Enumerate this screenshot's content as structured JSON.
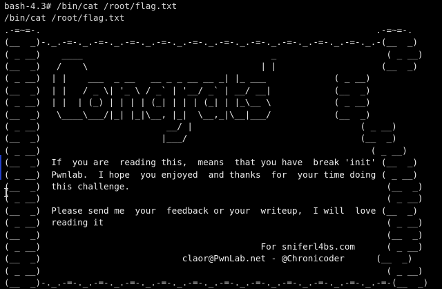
{
  "terminal": {
    "prompt_line": "bash-4.3# /bin/cat /root/flag.txt",
    "echo_line": "/bin/cat /root/flag.txt",
    "border": {
      "top": ".-=~=-.                                                                .-=~=-.",
      "bottom_chain": "(__  _)-._.-=-._.-=-._.-=-._.-=-._.-=-._.-=-._.-=-._.-=-._.-=-._.-=-._.-(__  _)"
    },
    "ascii_title": [
      "(__  _)-._.-=-._.-=-._.-=-._.-=-._.-=-._.-=-._.-=-._.-=-._.-=-._.-=-._.-(__  _)",
      "( _ __)    ____                                    _                     ( _ __)",
      "(__  _)   /    \\                                 | |                    (__  _)",
      "( _ __)  | |    ___  _ __   __ _ _ __ __ _| |_ ___             ( _ __)",
      "(__  _)  | |   / _ \\| '_ \\ / _` | '__/ _` | __/ __|            (__  _)",
      "( _ __)  | |  | (_) | | | | (_| | | | (_| | |_\\__ \\            ( _ __)",
      "(__  _)   \\____\\___/|_| |_|\\__, |_|  \\__,_|\\__|___/            (__  _)",
      "( _ __)                        __/ |                                ( _ __)",
      "(__  _)                       |___/                                 (__  _)",
      "( _ __)                                                               ( _ __)"
    ],
    "message": [
      "(__  _)  If  you are  reading this,  means  that you have  break 'init' (__  _)",
      "( _ __)  Pwnlab.  I hope  you enjoyed  and thanks  for  your time doing ( _ __)",
      "(__  _)  this challenge.                                                 (__  _)",
      "( _ __)                                                                  ( _ __)",
      "(__  _)  Please send me  your  feedback or your  writeup,  I will  love (__  _)",
      "( _ __)  reading it                                                      ( _ __)",
      "(__  _)                                                                  (__  _)",
      "( _ __)                                          For sniferl4bs.com      ( _ __)",
      "(__  _)                           claor@PwnLab.net - @Chronicoder      (__  _)",
      "( _ __)                                                                  ( _ __)",
      "(__  _)-._.-=-._.-=-._.-=-._.-=-._.-=-._.-=-._.-=-._.-=-._.-=-._.-=-._.-=-(__  _)",
      "`-._.-'                                                                  `-._.-'"
    ]
  }
}
